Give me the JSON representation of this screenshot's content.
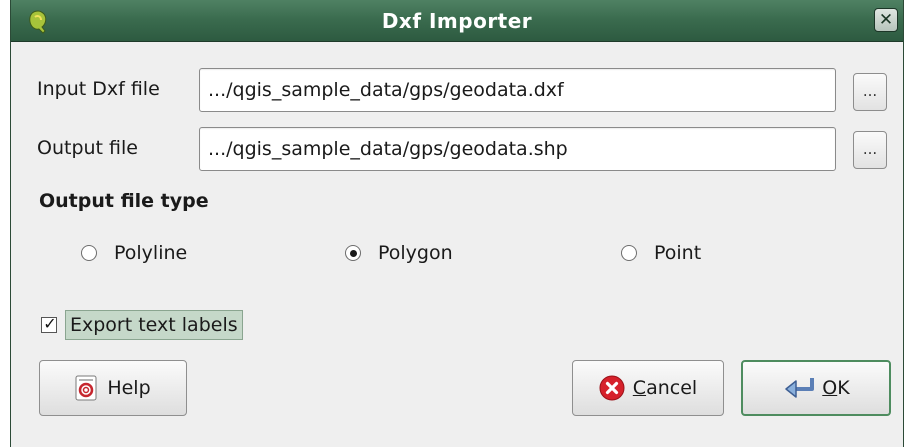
{
  "window": {
    "title": "Dxf Importer",
    "close_glyph": "✕"
  },
  "form": {
    "input_label": "Input Dxf file",
    "input_value": ".../qgis_sample_data/gps/geodata.dxf",
    "input_browse_label": "...",
    "output_label": "Output file",
    "output_value": ".../qgis_sample_data/gps/geodata.shp",
    "output_browse_label": "..."
  },
  "file_type": {
    "section_title": "Output file type",
    "options": [
      {
        "label": "Polyline",
        "checked": false
      },
      {
        "label": "Polygon",
        "checked": true
      },
      {
        "label": "Point",
        "checked": false
      }
    ]
  },
  "export_labels": {
    "label": "Export text labels",
    "checked": true,
    "check_glyph": "✓"
  },
  "buttons": {
    "help": {
      "label": "Help",
      "icon": "help-icon"
    },
    "cancel": {
      "mnemonic": "C",
      "rest": "ancel",
      "icon": "cancel-icon"
    },
    "ok": {
      "mnemonic": "O",
      "rest": "K",
      "icon": "enter-icon"
    }
  },
  "colors": {
    "titlebar": "#3a6b4e",
    "accent_green": "#4e8c5f",
    "cancel_red": "#d6212b"
  }
}
